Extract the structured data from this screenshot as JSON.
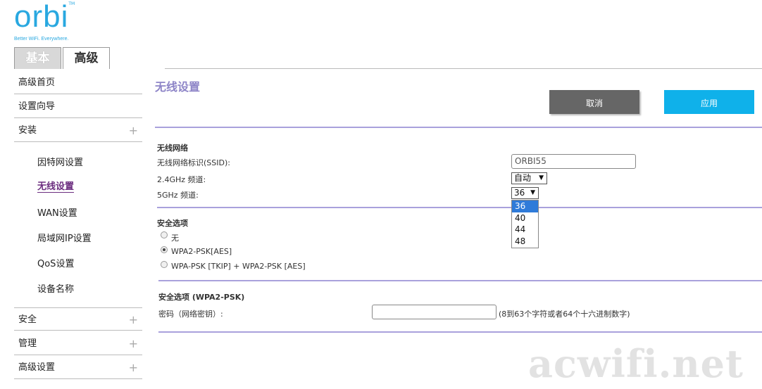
{
  "logo": {
    "word": "orbi",
    "tm": "TM",
    "tagline": "Better WiFi. Everywhere."
  },
  "tabs": [
    {
      "label": "基本"
    },
    {
      "label": "高级"
    }
  ],
  "sidebar": {
    "items": [
      {
        "label": "高级首页"
      },
      {
        "label": "设置向导"
      },
      {
        "label": "安装",
        "expander": "+"
      },
      {
        "label": "安全",
        "expander": "+"
      },
      {
        "label": "管理",
        "expander": "+"
      },
      {
        "label": "高级设置",
        "expander": "+"
      }
    ],
    "subitems": [
      {
        "label": "因特网设置"
      },
      {
        "label": "无线设置"
      },
      {
        "label": "WAN设置"
      },
      {
        "label": "局域网IP设置"
      },
      {
        "label": "QoS设置"
      },
      {
        "label": "设备名称"
      }
    ]
  },
  "main": {
    "title": "无线设置",
    "cancel_label": "取消",
    "apply_label": "应用",
    "wireless": {
      "section_title": "无线网络",
      "ssid_label": "无线网络标识(SSID):",
      "ssid_value": "ORBI55",
      "ch24_label": "2.4GHz 频道:",
      "ch24_value": "自动",
      "ch5_label": "5GHz 频道:",
      "ch5_value": "36",
      "ch5_options": [
        "36",
        "40",
        "44",
        "48"
      ]
    },
    "security": {
      "section_title": "安全选项",
      "options": [
        "无",
        "WPA2-PSK[AES]",
        "WPA-PSK [TKIP] + WPA2-PSK [AES]"
      ],
      "selected": "WPA2-PSK[AES]"
    },
    "psk": {
      "section_title": "安全选项 (WPA2-PSK)",
      "password_label": "密码（网络密钥）:",
      "password_value": "",
      "hint": "(8到63个字符或者64个十六进制数字)"
    }
  },
  "watermark": "acwifi.net",
  "colors": {
    "accent": "#29a8e0",
    "apply": "#0fb1ea",
    "cancel": "#666666",
    "title": "#8d84c7",
    "active_link": "#6b2d7f"
  }
}
